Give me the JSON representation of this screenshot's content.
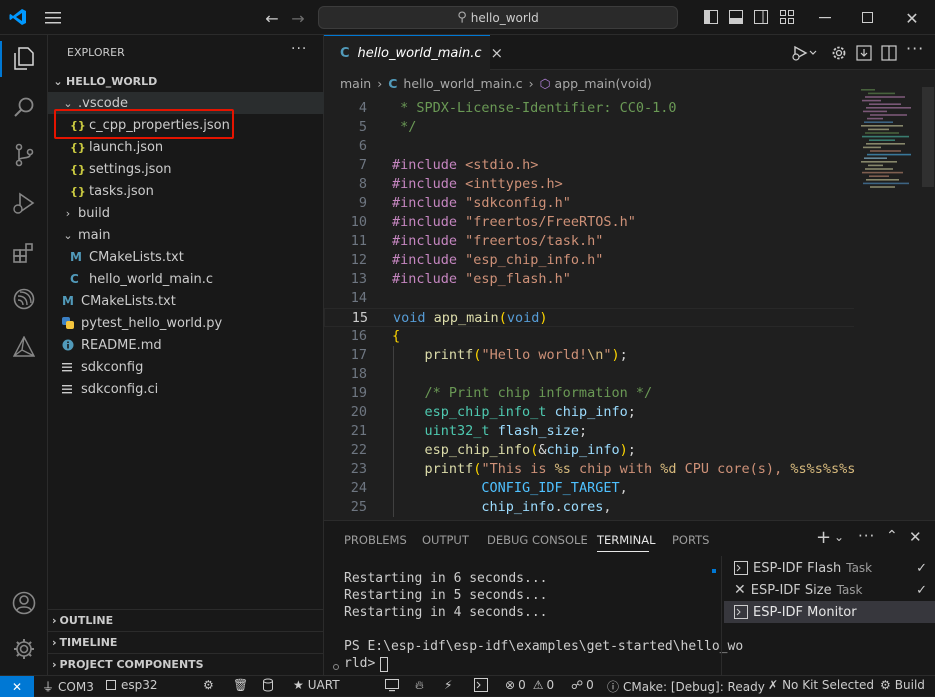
{
  "title_search": "hello_world",
  "colors": {
    "accent": "#0078d4",
    "red_box": "#e51400",
    "keyword": "#569cd6",
    "func": "#dcdcaa",
    "string": "#ce9178",
    "comment": "#6a9955",
    "macro": "#c586c0",
    "type": "#4ec9b0",
    "var": "#9cdcfe",
    "const": "#4fc1ff",
    "json_icon": "#cbcb41",
    "c_icon": "#519aba",
    "cmake_icon": "#6d8086",
    "py_icon": "#3b80c4"
  },
  "icons": {
    "app": "vscode-logo-icon",
    "menu": "hamburger-icon",
    "back": "arrow-left-icon",
    "forward": "arrow-right-icon",
    "search": "search-icon",
    "explorer": "files-icon",
    "git": "source-control-icon",
    "debug": "run-debug-icon",
    "extensions": "extensions-icon",
    "espidf": "espressif-icon",
    "cmake": "cmake-icon",
    "account": "account-icon",
    "settings": "gear-icon"
  },
  "explorer": {
    "header": "EXPLORER",
    "more": "···",
    "root": "HELLO_WORLD",
    "items": [
      {
        "label": ".vscode",
        "type": "folder-open"
      },
      {
        "label": "c_cpp_properties.json",
        "type": "json",
        "icon": "{}"
      },
      {
        "label": "launch.json",
        "type": "json",
        "icon": "{}"
      },
      {
        "label": "settings.json",
        "type": "json",
        "icon": "{}"
      },
      {
        "label": "tasks.json",
        "type": "json",
        "icon": "{}"
      },
      {
        "label": "build",
        "type": "folder"
      },
      {
        "label": "main",
        "type": "folder-open"
      },
      {
        "label": "CMakeLists.txt",
        "type": "cmake",
        "icon": "M"
      },
      {
        "label": "hello_world_main.c",
        "type": "c",
        "icon": "C"
      },
      {
        "label": "CMakeLists.txt",
        "type": "cmake",
        "icon": "M"
      },
      {
        "label": "pytest_hello_world.py",
        "type": "py"
      },
      {
        "label": "README.md",
        "type": "info"
      },
      {
        "label": "sdkconfig",
        "type": "lines"
      },
      {
        "label": "sdkconfig.ci",
        "type": "lines"
      }
    ],
    "sections": [
      "OUTLINE",
      "TIMELINE",
      "PROJECT COMPONENTS"
    ]
  },
  "editor": {
    "tab_icon": "C",
    "tab_label": "hello_world_main.c",
    "tab_close": "×",
    "breadcrumb": [
      "main",
      "hello_world_main.c",
      "app_main(void)"
    ],
    "lines": [
      {
        "n": "4",
        "code": " * SPDX-License-Identifier: CC0-1.0"
      },
      {
        "n": "5",
        "code": " */"
      },
      {
        "n": "6",
        "code": ""
      },
      {
        "n": "7",
        "code": "#include <stdio.h>"
      },
      {
        "n": "8",
        "code": "#include <inttypes.h>"
      },
      {
        "n": "9",
        "code": "#include \"sdkconfig.h\""
      },
      {
        "n": "10",
        "code": "#include \"freertos/FreeRTOS.h\""
      },
      {
        "n": "11",
        "code": "#include \"freertos/task.h\""
      },
      {
        "n": "12",
        "code": "#include \"esp_chip_info.h\""
      },
      {
        "n": "13",
        "code": "#include \"esp_flash.h\""
      },
      {
        "n": "14",
        "code": ""
      },
      {
        "n": "15",
        "code": "void app_main(void)"
      },
      {
        "n": "16",
        "code": "{"
      },
      {
        "n": "17",
        "code": "    printf(\"Hello world!\\n\");"
      },
      {
        "n": "18",
        "code": ""
      },
      {
        "n": "19",
        "code": "    /* Print chip information */"
      },
      {
        "n": "20",
        "code": "    esp_chip_info_t chip_info;"
      },
      {
        "n": "21",
        "code": "    uint32_t flash_size;"
      },
      {
        "n": "22",
        "code": "    esp_chip_info(&chip_info);"
      },
      {
        "n": "23",
        "code": "    printf(\"This is %s chip with %d CPU core(s), %s%s%s%s, \""
      },
      {
        "n": "24",
        "code": "           CONFIG_IDF_TARGET,"
      },
      {
        "n": "25",
        "code": "           chip_info.cores,"
      }
    ],
    "current_line": "15"
  },
  "panel": {
    "tabs": [
      "PROBLEMS",
      "OUTPUT",
      "DEBUG CONSOLE",
      "TERMINAL",
      "PORTS"
    ],
    "active_tab": "TERMINAL",
    "terminal_lines": [
      "Restarting in 6 seconds...",
      "Restarting in 5 seconds...",
      "Restarting in 4 seconds...",
      "",
      "PS E:\\esp-idf\\esp-idf\\examples\\get-started\\hello_wo",
      "rld> "
    ],
    "tasks": [
      {
        "name": "ESP-IDF Flash",
        "suffix": "Task",
        "check": true
      },
      {
        "name": "ESP-IDF Size",
        "suffix": "Task",
        "check": true
      },
      {
        "name": "ESP-IDF Monitor",
        "suffix": "",
        "check": false
      }
    ]
  },
  "status": {
    "remote": "✕",
    "port": "COM3",
    "target": "esp32",
    "uart": "UART",
    "errors": "0",
    "warnings": "0",
    "ports": "0",
    "cmake": "CMake: [Debug]: Ready",
    "kit": "No Kit Selected",
    "build": "Build"
  }
}
